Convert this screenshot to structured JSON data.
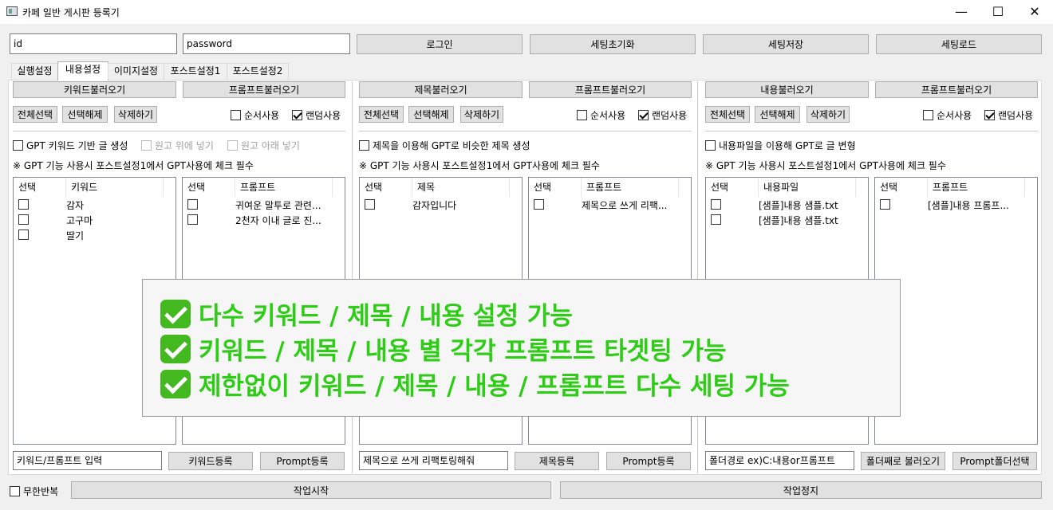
{
  "window": {
    "title": "카페 일반 게시판 등록기",
    "minimize": "—",
    "maximize": "☐",
    "close": "✕"
  },
  "login": {
    "id_value": "id",
    "password_value": "password",
    "login_label": "로그인",
    "reset_label": "세팅초기화",
    "save_label": "세팅저장",
    "load_label": "세팅로드"
  },
  "tabs": [
    "실행설정",
    "내용설정",
    "이미지설정",
    "포스트설정1",
    "포스트설정2"
  ],
  "active_tab": "내용설정",
  "columns": [
    {
      "load_label": "키워드불러오기",
      "prompt_load_label": "프롬프트불러오기",
      "select_all": "전체선택",
      "deselect": "선택해제",
      "delete": "삭제하기",
      "sequential": "순서사용",
      "sequential_checked": false,
      "random": "랜덤사용",
      "random_checked": true,
      "gpt_option": "GPT 키워드 기반 글 생성",
      "gpt_option_checked": false,
      "extra_option_1": "원고 위에 넣기",
      "extra_option_2": "원고 아래 넣기",
      "note": "※ GPT 기능 사용시 포스트설정1에서 GPT사용에 체크 필수",
      "left_list": {
        "headers": [
          "선택",
          "키워드"
        ],
        "rows": [
          "감자",
          "고구마",
          "딸기"
        ]
      },
      "right_list": {
        "headers": [
          "선택",
          "프롬프트"
        ],
        "rows": [
          "귀여운 말투로 관련...",
          "2천자 이내 글로 진..."
        ]
      },
      "input_value": "키워드/프롬프트 입력",
      "register_label": "키워드등록",
      "prompt_register_label": "Prompt등록"
    },
    {
      "load_label": "제목불러오기",
      "prompt_load_label": "프롬프트불러오기",
      "select_all": "전체선택",
      "deselect": "선택해제",
      "delete": "삭제하기",
      "sequential": "순서사용",
      "sequential_checked": false,
      "random": "랜덤사용",
      "random_checked": true,
      "gpt_option": "제목을 이용해 GPT로 비슷한 제목 생성",
      "gpt_option_checked": false,
      "note": "※ GPT 기능 사용시 포스트설정1에서 GPT사용에 체크 필수",
      "left_list": {
        "headers": [
          "선택",
          "제목"
        ],
        "rows": [
          "감자입니다"
        ]
      },
      "right_list": {
        "headers": [
          "선택",
          "프롬프트"
        ],
        "rows": [
          "제목으로 쓰게 리팩..."
        ]
      },
      "input_value": "제목으로 쓰게 리팩토링해줘",
      "register_label": "제목등록",
      "prompt_register_label": "Prompt등록"
    },
    {
      "load_label": "내용불러오기",
      "prompt_load_label": "프롬프트불러오기",
      "select_all": "전체선택",
      "deselect": "선택해제",
      "delete": "삭제하기",
      "sequential": "순서사용",
      "sequential_checked": false,
      "random": "랜덤사용",
      "random_checked": true,
      "gpt_option": "내용파일을 이용해 GPT로 글 변형",
      "gpt_option_checked": false,
      "note": "※ GPT 기능 사용시 포스트설정1에서 GPT사용에 체크 필수",
      "left_list": {
        "headers": [
          "선택",
          "내용파일"
        ],
        "rows": [
          "[샘플]내용 샘플.txt",
          "[샘플]내용 샘플.txt"
        ]
      },
      "right_list": {
        "headers": [
          "선택",
          "프롬프트"
        ],
        "rows": [
          "[샘플]내용 프롬프..."
        ]
      },
      "input_value": "폴더경로 ex)C:내용or프롬프트",
      "register_label": "폴더째로 불러오기",
      "prompt_register_label": "Prompt폴더선택"
    }
  ],
  "bottom": {
    "infinite_repeat": "무한반복",
    "infinite_checked": false,
    "start_label": "작업시작",
    "stop_label": "작업정지"
  },
  "overlay": {
    "lines": [
      "다수 키워드 / 제목 / 내용 설정 가능",
      "키워드 / 제목 / 내용 별 각각 프롬프트 타겟팅 가능",
      "제한없이 키워드 / 제목 / 내용 / 프롬프트 다수 세팅 가능"
    ],
    "accent": "#2dcc15"
  }
}
